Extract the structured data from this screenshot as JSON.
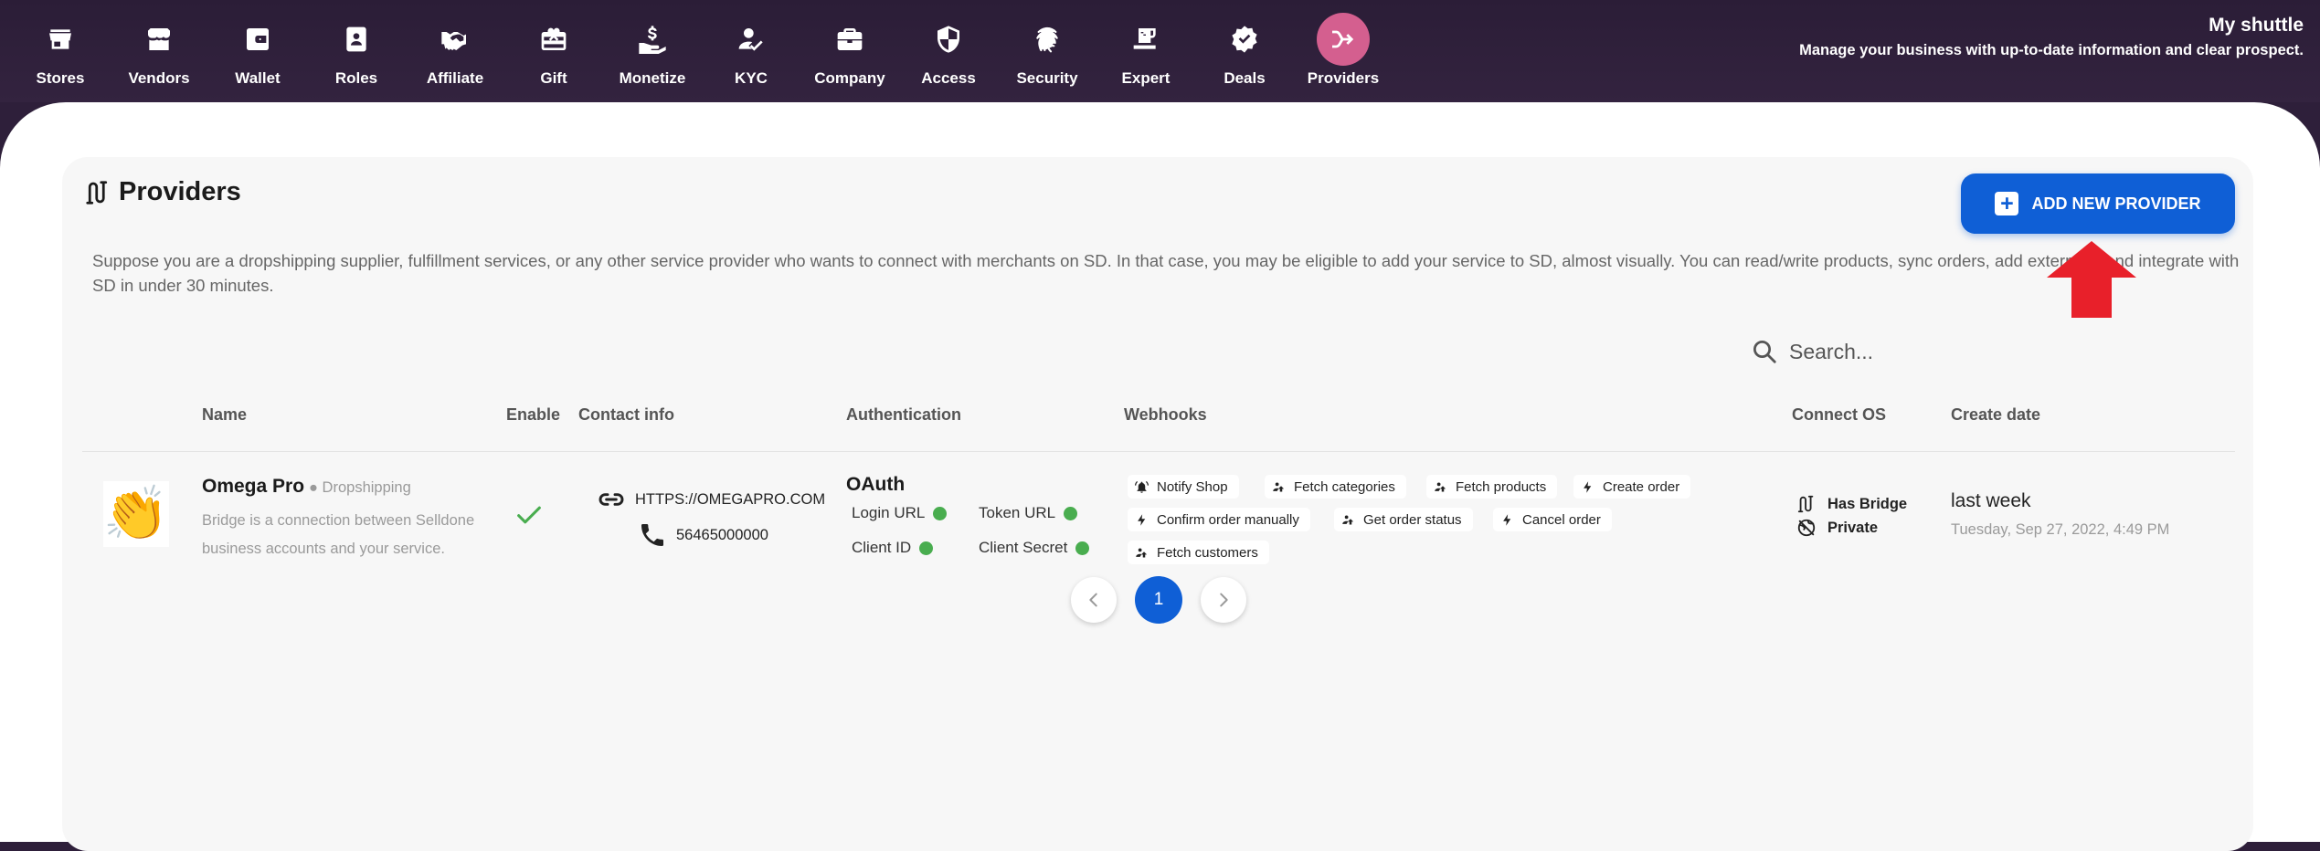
{
  "nav": {
    "items": [
      {
        "label": "Stores",
        "icon": "store-icon"
      },
      {
        "label": "Vendors",
        "icon": "vendor-icon"
      },
      {
        "label": "Wallet",
        "icon": "wallet-icon"
      },
      {
        "label": "Roles",
        "icon": "badge-icon"
      },
      {
        "label": "Affiliate",
        "icon": "handshake-icon"
      },
      {
        "label": "Gift",
        "icon": "gift-card-icon"
      },
      {
        "label": "Monetize",
        "icon": "hand-money-icon"
      },
      {
        "label": "KYC",
        "icon": "person-check-icon"
      },
      {
        "label": "Company",
        "icon": "briefcase-icon"
      },
      {
        "label": "Access",
        "icon": "shield-icon"
      },
      {
        "label": "Security",
        "icon": "fingerprint-icon"
      },
      {
        "label": "Expert",
        "icon": "coffee-icon"
      },
      {
        "label": "Deals",
        "icon": "verified-badge-icon"
      },
      {
        "label": "Providers",
        "icon": "providers-icon",
        "active": true
      }
    ]
  },
  "brand": {
    "title": "My shuttle",
    "subtitle": "Manage your business with up-to-date information and clear prospect."
  },
  "page": {
    "title": "Providers",
    "add_button": "ADD NEW PROVIDER",
    "description": "Suppose you are a dropshipping supplier, fulfillment services, or any other service provider who wants to connect with merchants on SD. In that case, you may be eligible to add your service to SD, almost visually. You can read/write products, sync orders, add external c   and integrate with SD in under 30 minutes.",
    "search_placeholder": "Search..."
  },
  "table": {
    "headers": {
      "name": "Name",
      "enable": "Enable",
      "contact": "Contact info",
      "auth": "Authentication",
      "webhooks": "Webhooks",
      "connect_os": "Connect OS",
      "create_date": "Create date"
    },
    "rows": [
      {
        "avatar": "👏",
        "name": "Omega Pro",
        "type": "● Dropshipping",
        "description": "Bridge is a connection between Selldone business accounts and your service.",
        "enabled": true,
        "url": "HTTPS://OMEGAPRO.COM",
        "phone": "56465000000",
        "auth_type": "OAuth",
        "auth_items": [
          "Login URL",
          "Token URL",
          "Client ID",
          "Client Secret"
        ],
        "webhooks": [
          "Notify Shop",
          "Fetch categories",
          "Fetch products",
          "Create order",
          "Confirm order manually",
          "Get order status",
          "Cancel order",
          "Fetch customers"
        ],
        "os": [
          "Has Bridge",
          "Private"
        ],
        "date_relative": "last week",
        "date_full": "Tuesday, Sep 27, 2022, 4:49 PM"
      }
    ]
  },
  "pagination": {
    "current": "1"
  }
}
